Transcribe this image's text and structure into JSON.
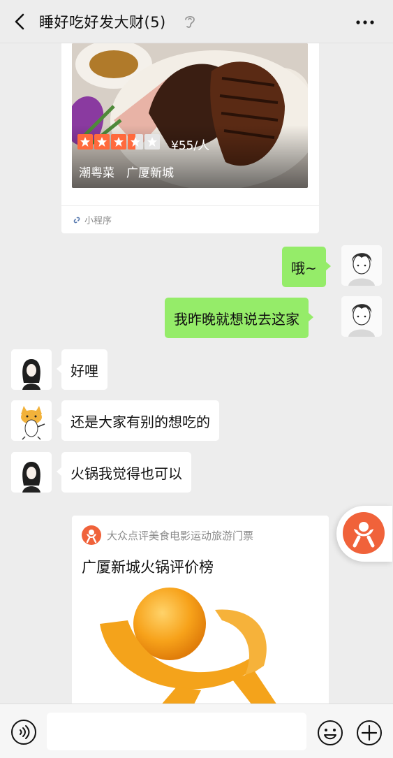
{
  "header": {
    "title": "睡好吃好发大财(5)"
  },
  "mini_program": {
    "rating": 3.5,
    "price": "¥55/人",
    "tags": "潮粤菜　广厦新城",
    "footer_label": "小程序"
  },
  "messages": [
    {
      "side": "right",
      "text": "哦~"
    },
    {
      "side": "right",
      "text": "我昨晚就想说去这家"
    },
    {
      "side": "left",
      "text": "好哩"
    },
    {
      "side": "left",
      "text": "还是大家有别的想吃的"
    },
    {
      "side": "left",
      "text": "火锅我觉得也可以"
    }
  ],
  "share_card": {
    "source": "大众点评美食电影运动旅游门票",
    "title": "广厦新城火锅评价榜"
  },
  "colors": {
    "accent_green": "#95ec69",
    "dianping_orange": "#f0623a",
    "background": "#ededed"
  }
}
